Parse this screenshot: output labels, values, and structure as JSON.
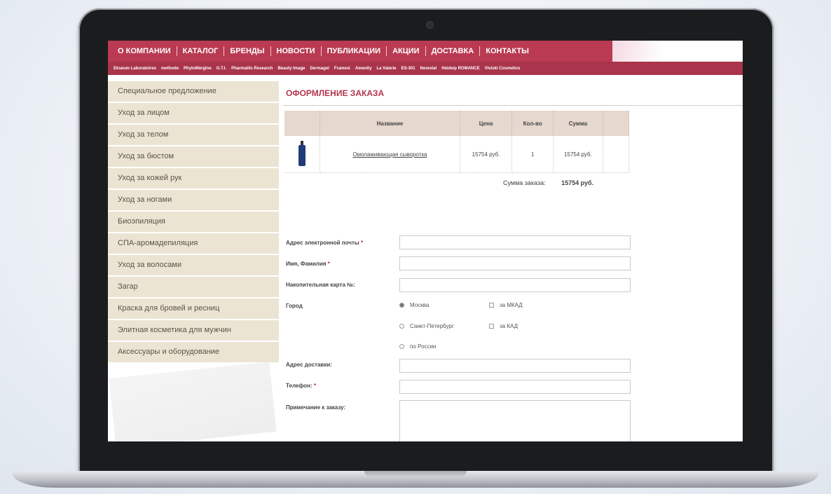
{
  "nav": {
    "items": [
      "О КОМПАНИИ",
      "КАТАЛОГ",
      "БРЕНДЫ",
      "НОВОСТИ",
      "ПУБЛИКАЦИИ",
      "АКЦИИ",
      "ДОСТАВКА",
      "КОНТАКТЫ"
    ]
  },
  "brands": [
    "Ekseum Laboratoires",
    "methode",
    "PhytoMergine",
    "G.T.I.",
    "Pharmatils Research",
    "Beauty Image",
    "Dermagel",
    "Framesi",
    "Amenity",
    "La Valerie",
    "ES-301",
    "Neorelal",
    "Heideip ROMANCE",
    "Viviski Cosmetics"
  ],
  "sidebar": {
    "items": [
      "Специальное предложение",
      "Уход за лицом",
      "Уход за телом",
      "Уход за бюстом",
      "Уход за кожей рук",
      "Уход за ногами",
      "Биоэпиляция",
      "СПА-аромадепиляция",
      "Уход за волосами",
      "Загар",
      "Краска для бровей и ресниц",
      "Элитная косметика для мужчин",
      "Аксессуары и оборудование"
    ]
  },
  "page": {
    "title": "ОФОРМЛЕНИЕ ЗАКАЗА"
  },
  "cart": {
    "headers": [
      "Название",
      "Цена",
      "Кол-во",
      "Сумма"
    ],
    "rows": [
      {
        "name": "Омолаживающая сыворотка",
        "price": "15754 руб.",
        "qty": "1",
        "sum": "15754 руб."
      }
    ],
    "total_label": "Сумма заказа:",
    "total_value": "15754 руб."
  },
  "form": {
    "email_label": "Адрес электронной почты",
    "name_label": "Имя, Фамилия",
    "card_label": "Накопительная карта №:",
    "city_label": "Город",
    "city_options": [
      "Москва",
      "Санкт-Петербург",
      "по России"
    ],
    "city_selected": "Москва",
    "zone_options": [
      "за МКАД",
      "за КАД"
    ],
    "address_label": "Адрес доставки:",
    "phone_label": "Телефон:",
    "note_label": "Примечание к заказу:",
    "required_mark": "*"
  },
  "colors": {
    "accent": "#b93a52",
    "brand_bar": "#a9344b",
    "sidebar_bg": "#ece4d3",
    "table_header": "#e6d8ce"
  }
}
